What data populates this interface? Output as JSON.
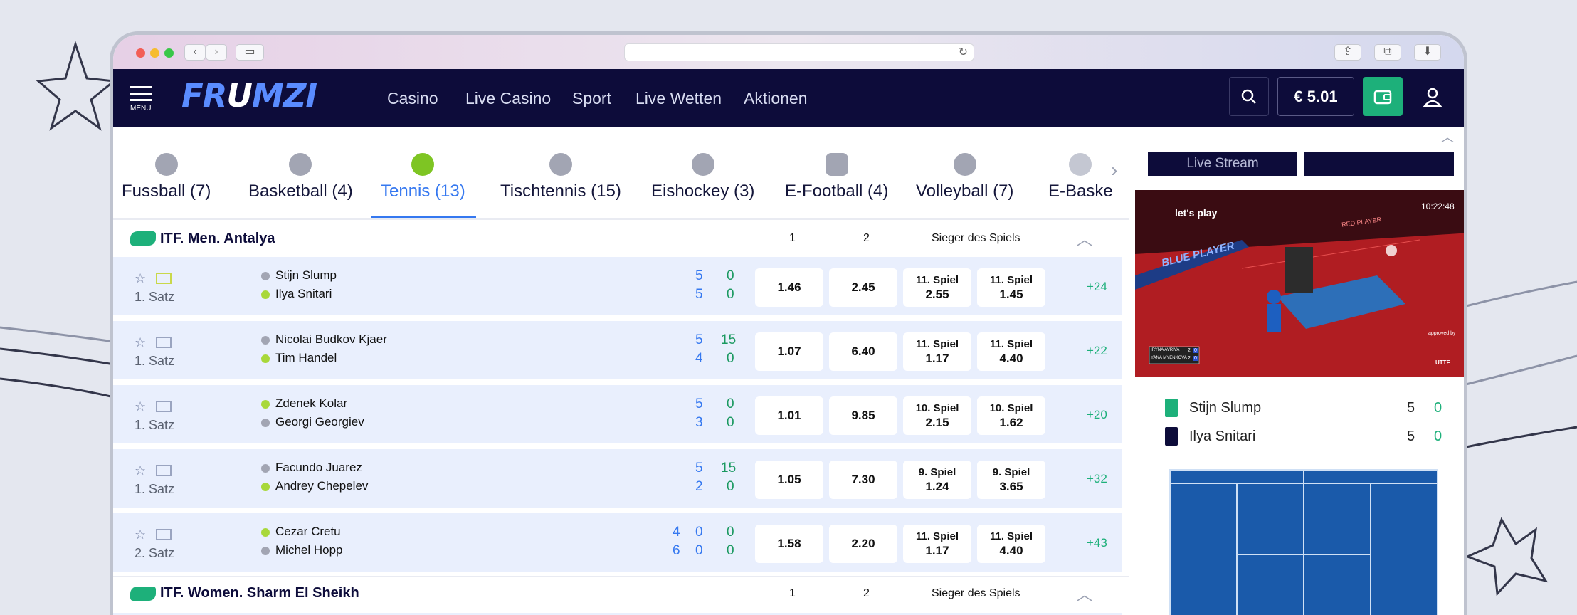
{
  "menu_label": "MENU",
  "logo": {
    "part1": "FR",
    "part2": "U",
    "part3": "MZI"
  },
  "nav": [
    "Casino",
    "Live Casino",
    "Sport",
    "Live Wetten",
    "Aktionen"
  ],
  "balance": "€ 5.01",
  "sports": [
    {
      "label": "Fussball (7)"
    },
    {
      "label": "Basketball (4)"
    },
    {
      "label": "Tennis (13)"
    },
    {
      "label": "Tischtennis (15)"
    },
    {
      "label": "Eishockey (3)"
    },
    {
      "label": "E-Football (4)"
    },
    {
      "label": "Volleyball (7)"
    },
    {
      "label": "E-Baske"
    }
  ],
  "leagues": [
    {
      "name": "ITF. Men. Antalya",
      "col1": "1",
      "col2": "2",
      "col3": "Sieger des Spiels"
    },
    {
      "name": "ITF. Women. Sharm El Sheikh",
      "col1": "1",
      "col2": "2",
      "col3": "Sieger des Spiels"
    }
  ],
  "matches": [
    {
      "set": "1. Satz",
      "p1": "Stijn Slump",
      "p2": "Ilya Snitari",
      "s1a": "",
      "s1b": "5",
      "s1c": "0",
      "s2a": "",
      "s2b": "5",
      "s2c": "0",
      "o1": "1.46",
      "o2": "2.45",
      "g1t": "11. Spiel",
      "g1": "2.55",
      "g2t": "11. Spiel",
      "g2": "1.45",
      "more": "+24"
    },
    {
      "set": "1. Satz",
      "p1": "Nicolai Budkov Kjaer",
      "p2": "Tim Handel",
      "s1a": "",
      "s1b": "5",
      "s1c": "15",
      "s2a": "",
      "s2b": "4",
      "s2c": "0",
      "o1": "1.07",
      "o2": "6.40",
      "g1t": "11. Spiel",
      "g1": "1.17",
      "g2t": "11. Spiel",
      "g2": "4.40",
      "more": "+22"
    },
    {
      "set": "1. Satz",
      "p1": "Zdenek Kolar",
      "p2": "Georgi Georgiev",
      "s1a": "",
      "s1b": "5",
      "s1c": "0",
      "s2a": "",
      "s2b": "3",
      "s2c": "0",
      "o1": "1.01",
      "o2": "9.85",
      "g1t": "10. Spiel",
      "g1": "2.15",
      "g2t": "10. Spiel",
      "g2": "1.62",
      "more": "+20"
    },
    {
      "set": "1. Satz",
      "p1": "Facundo Juarez",
      "p2": "Andrey Chepelev",
      "s1a": "",
      "s1b": "5",
      "s1c": "15",
      "s2a": "",
      "s2b": "2",
      "s2c": "0",
      "o1": "1.05",
      "o2": "7.30",
      "g1t": "9. Spiel",
      "g1": "1.24",
      "g2t": "9. Spiel",
      "g2": "3.65",
      "more": "+32"
    },
    {
      "set": "2. Satz",
      "p1": "Cezar Cretu",
      "p2": "Michel Hopp",
      "s1a": "4",
      "s1b": "0",
      "s1c": "0",
      "s2a": "6",
      "s2b": "0",
      "s2c": "0",
      "o1": "1.58",
      "o2": "2.20",
      "g1t": "11. Spiel",
      "g1": "1.17",
      "g2t": "11. Spiel",
      "g2": "4.40",
      "more": "+43"
    }
  ],
  "right_panel": {
    "tab_live": "Live Stream",
    "tab2": "",
    "video_brand": "let's play",
    "video_time": "10:22:48",
    "video_blue": "BLUE PLAYER",
    "video_red": "RED PLAYER",
    "video_sb1": "IRYNA AVRIVA",
    "video_sb2": "YANA MYENKOVA",
    "video_sb_s1a": "2",
    "video_sb_s1b": "0",
    "video_sb_s2a": "2",
    "video_sb_s2b": "0",
    "video_approved": "approved by",
    "video_uttf": "UTTF",
    "sb_p1": "Stijn Slump",
    "sb_p1_set": "5",
    "sb_p1_game": "0",
    "sb_p2": "Ilya Snitari",
    "sb_p2_set": "5",
    "sb_p2_game": "0"
  },
  "colors": {
    "nav_bg": "#0d0c3a",
    "accent": "#3578f0",
    "green": "#1db07a",
    "row_bg": "#e9effd",
    "court": "#1a5aaa"
  }
}
